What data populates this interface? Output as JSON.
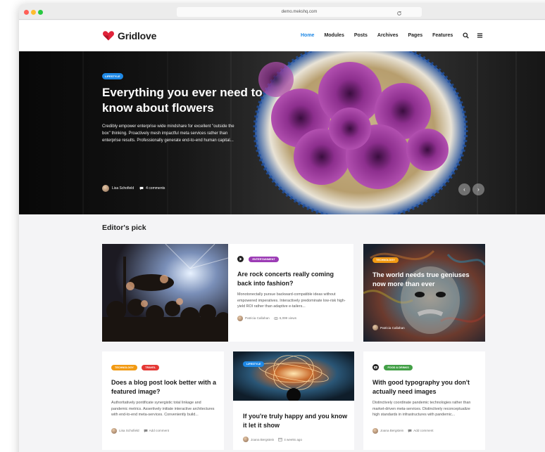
{
  "browser": {
    "url": "demo.mekshq.com"
  },
  "site": {
    "name": "Gridlove"
  },
  "nav": {
    "items": [
      {
        "label": "Home",
        "active": true
      },
      {
        "label": "Modules",
        "active": false
      },
      {
        "label": "Posts",
        "active": false
      },
      {
        "label": "Archives",
        "active": false
      },
      {
        "label": "Pages",
        "active": false
      },
      {
        "label": "Features",
        "active": false
      }
    ],
    "icons": [
      "search-icon",
      "menu-icon"
    ]
  },
  "hero": {
    "category": "Lifestyle",
    "title": "Everything you ever need to know about flowers",
    "excerpt": "Credibly empower enterprise wide mindshare for excellent \"outside the box\" thinking. Proactively mesh impactful meta services rather than enterprise results. Professionally generate end-to-end human capital...",
    "author": "Lisa Schofield",
    "comments": "4 comments"
  },
  "section": {
    "title": "Editor's pick"
  },
  "cards": [
    {
      "categories": [
        "Entertainment"
      ],
      "title": "Are rock concerts really coming back into fashion?",
      "excerpt": "Monotonectally pursue backward-compatible ideas without empowered imperatives. Interactively predominate low-risk high-yield ROI rather than adaptive e-tailers...",
      "author": "Patricia Callahan",
      "views": "6,099 views"
    },
    {
      "categories": [
        "Technology"
      ],
      "title": "The world needs true geniuses now more than ever",
      "author": "Patricia Callahan"
    },
    {
      "categories": [
        "Technology",
        "Travel"
      ],
      "title": "Does a blog post look better with a featured image?",
      "excerpt": "Authoritatively pontificate synergistic total linkage and pandemic metrics. Assertively initiate interactive architectures with end-to-end meta-services. Conveniently build...",
      "author": "Lisa Schofield",
      "comments": "Add comment"
    },
    {
      "categories": [
        "Lifestyle"
      ],
      "title": "If you're truly happy and you know it let it show",
      "author": "Joana Bergstein",
      "date": "4 weeks ago"
    },
    {
      "categories": [
        "Food & Drinks"
      ],
      "title": "With good typography you don't actually need images",
      "excerpt": "Distinctively coordinate pandemic technologies rather than market-driven meta-services. Distinctively reconceptualize high standards in infrastructures with pandemic...",
      "author": "Joana Bergstein",
      "comments": "Add comment"
    }
  ],
  "colors": {
    "accent": "#1e88e5",
    "logo": "#e0233a",
    "entertainment": "#9c3cb5",
    "technology": "#f29a12",
    "travel": "#e53935",
    "food": "#43a047"
  }
}
